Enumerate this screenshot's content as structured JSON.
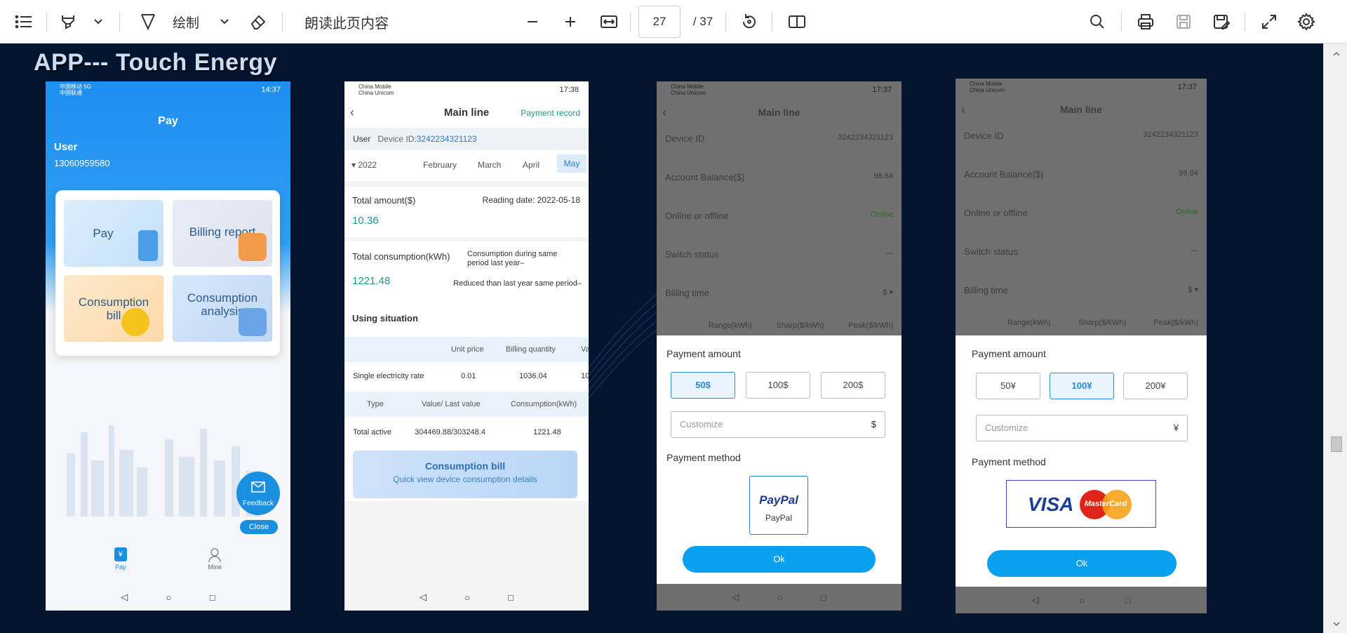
{
  "toolbar": {
    "draw_label": "绘制",
    "read_aloud_label": "朗读此页内容",
    "current_page": "27",
    "total_pages": "/ 37"
  },
  "slide": {
    "title": "APP--- Touch Energy"
  },
  "phone1": {
    "status_left_line1": "中国移动 5G",
    "status_left_line2": "中国联通",
    "status_time": "14:37",
    "title": "Pay",
    "user_label": "User",
    "user_phone": "13060959580",
    "tiles": [
      {
        "label": "Pay"
      },
      {
        "label": "Billing report"
      },
      {
        "label": "Consumption bill"
      },
      {
        "label": "Consumption analysis"
      }
    ],
    "feedback_label": "Feedback",
    "close_label": "Close",
    "tab_pay": "Pay",
    "tab_mine": "Mine",
    "tab_pay_glyph": "¥"
  },
  "phone2": {
    "status_left_line1": "China Mobile",
    "status_left_line2": "China Unicom",
    "status_time": "17:38",
    "title": "Main line",
    "payment_record": "Payment record",
    "user_label": "User",
    "device_id_label": "Device ID:",
    "device_id": "3242234321123",
    "year": "2022",
    "months": [
      "February",
      "March",
      "April",
      "May"
    ],
    "total_amount_label": "Total amount($)",
    "reading_date": "Reading date:  2022-05-18",
    "total_amount_value": "10.36",
    "total_consumption_label": "Total consumption(kWh)",
    "consumption_same_period": "Consumption during same period last year–",
    "total_consumption_value": "1221.48",
    "reduced_text": "Reduced than last year same period–",
    "using_situation": "Using situation",
    "table1_headers": [
      "Unit price",
      "Billing quantity",
      "Va"
    ],
    "table1_row": [
      "Single electricity rate",
      "0.01",
      "1036.04",
      "10"
    ],
    "table2_headers": [
      "Type",
      "Value/ Last value",
      "Consumption(kWh)"
    ],
    "table2_row": [
      "Total active",
      "304469.88/303248.4",
      "1221.48"
    ],
    "banner_title": "Consumption bill",
    "banner_sub": "Quick view device consumption details"
  },
  "phone3": {
    "status_left_line1": "China Mobile",
    "status_left_line2": "China Unicom",
    "status_time": "17:37",
    "title": "Main line",
    "rows": [
      {
        "label": "Device ID",
        "value": "3242234321123"
      },
      {
        "label": "Account Balance($)",
        "value": "98.84"
      },
      {
        "label": "Online or offline",
        "value": "Online"
      },
      {
        "label": "Switch status",
        "value": "—"
      },
      {
        "label": "Billing time",
        "value": "$ ▾"
      }
    ],
    "headers": [
      "Range(kWh)",
      "Sharp($/kWh)",
      "Peak($/kWh)"
    ],
    "payment_amount": "Payment amount",
    "amounts": [
      "50$",
      "100$",
      "200$"
    ],
    "customize": "Customize",
    "currency": "$",
    "payment_method": "Payment method",
    "paypal_logo": "PayPal",
    "paypal_label": "PayPal",
    "ok": "Ok"
  },
  "phone4": {
    "status_left_line1": "China Mobile",
    "status_left_line2": "China Unicom",
    "status_time": "17:37",
    "title": "Main line",
    "rows": [
      {
        "label": "Device ID",
        "value": "3242234321123"
      },
      {
        "label": "Account Balance($)",
        "value": "98.84"
      },
      {
        "label": "Online or offline",
        "value": "Online"
      },
      {
        "label": "Switch status",
        "value": "—"
      },
      {
        "label": "Billing time",
        "value": "$ ▾"
      }
    ],
    "headers": [
      "Range(kWh)",
      "Sharp($/kWh)",
      "Peak($/kWh)"
    ],
    "payment_amount": "Payment amount",
    "amounts": [
      "50¥",
      "100¥",
      "200¥"
    ],
    "customize": "Customize",
    "currency": "¥",
    "payment_method": "Payment method",
    "visa": "VISA",
    "mastercard": "MasterCard",
    "ok": "Ok"
  }
}
